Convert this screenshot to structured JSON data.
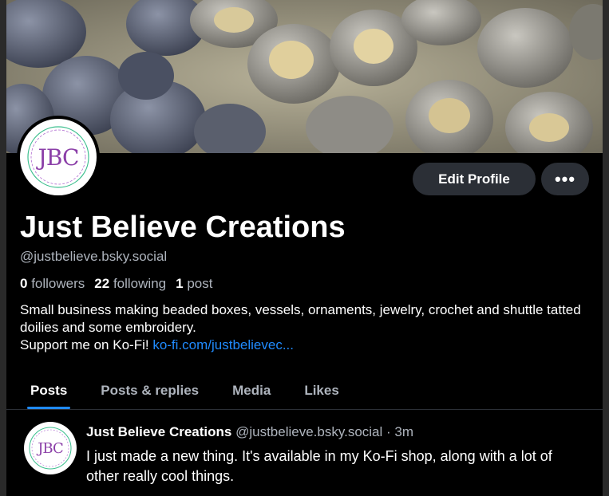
{
  "profile": {
    "display_name": "Just Believe Creations",
    "handle": "@justbelieve.bsky.social",
    "avatar_text": "JBC",
    "avatar_ring_text": "JUST BELIEVE CREATIONS",
    "followers_count": "0",
    "followers_label": "followers",
    "following_count": "22",
    "following_label": "following",
    "posts_count": "1",
    "posts_label": "post",
    "bio_line1": "Small business making beaded boxes, vessels, ornaments, jewelry, crochet and shuttle tatted doilies and some embroidery.",
    "bio_line2": "Support me on Ko-Fi! ",
    "bio_link": "ko-fi.com/justbelievec..."
  },
  "actions": {
    "edit_profile": "Edit Profile",
    "more": "•••"
  },
  "tabs": [
    {
      "label": "Posts",
      "active": true
    },
    {
      "label": "Posts & replies",
      "active": false
    },
    {
      "label": "Media",
      "active": false
    },
    {
      "label": "Likes",
      "active": false
    }
  ],
  "post": {
    "author_name": "Just Believe Creations",
    "author_handle": "@justbelieve.bsky.social",
    "separator": " · ",
    "time": "3m",
    "text": "I just made a new thing. It's available in my Ko-Fi shop, along with a lot of other really cool things."
  },
  "colors": {
    "background": "#000000",
    "accent_link": "#208bfe",
    "muted_text": "#aeb4bd",
    "button_bg": "#2b2f36"
  }
}
